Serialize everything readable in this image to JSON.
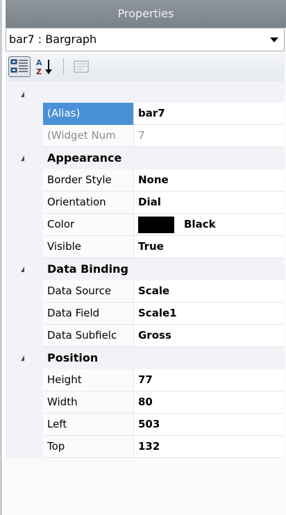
{
  "title": "Properties",
  "object_selector": {
    "value": "bar7 : Bargraph"
  },
  "toolbar": {
    "categorized": "categorized-icon",
    "alphabetical": "sort-az-icon",
    "pages": "property-pages-icon"
  },
  "rows_top": [
    {
      "name": "(Alias)",
      "value": "bar7",
      "selected": true
    },
    {
      "name": "(Widget Num",
      "value": "7",
      "dim": true
    }
  ],
  "categories": [
    {
      "label": "Appearance",
      "rows": [
        {
          "name": "Border Style",
          "value": "None"
        },
        {
          "name": "Orientation",
          "value": "Dial"
        },
        {
          "name": "Color",
          "value": "Black",
          "swatch": "#000000"
        },
        {
          "name": "Visible",
          "value": "True"
        }
      ]
    },
    {
      "label": "Data Binding",
      "rows": [
        {
          "name": "Data Source",
          "value": "Scale"
        },
        {
          "name": "Data Field",
          "value": "Scale1"
        },
        {
          "name": "Data Subfielc",
          "value": "Gross"
        }
      ]
    },
    {
      "label": "Position",
      "rows": [
        {
          "name": "Height",
          "value": "77"
        },
        {
          "name": "Width",
          "value": "80"
        },
        {
          "name": "Left",
          "value": "503"
        },
        {
          "name": "Top",
          "value": "132"
        }
      ]
    }
  ],
  "colors": {
    "selection": "#4a90d8",
    "titlebar": "#7f868e"
  }
}
